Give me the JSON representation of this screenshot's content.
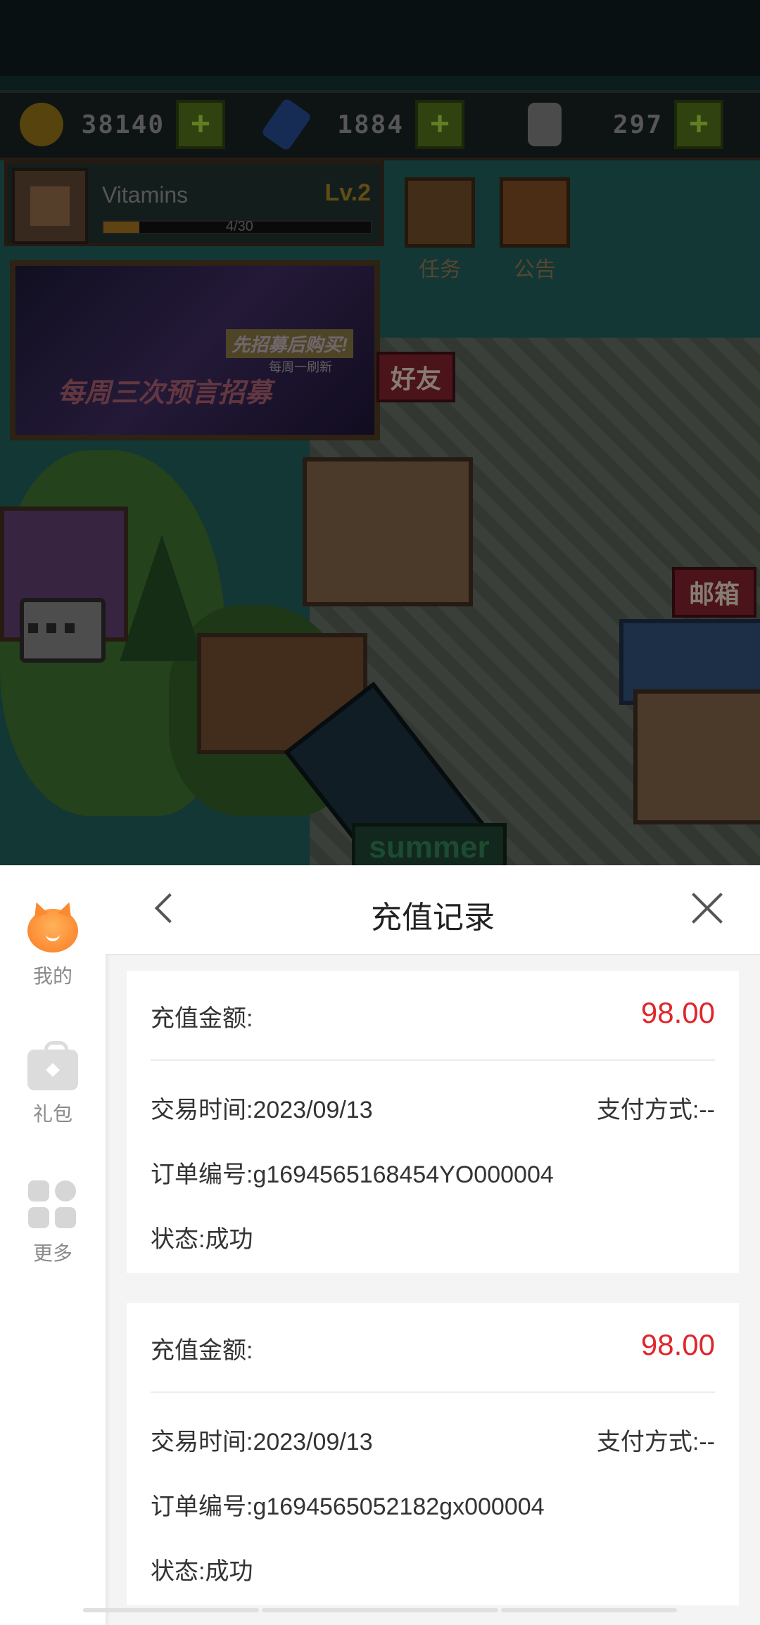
{
  "game": {
    "resources": [
      {
        "name": "gold",
        "value": "38140",
        "color": "#b28a1c"
      },
      {
        "name": "crystal",
        "value": "1884",
        "color": "#2e5aa8"
      },
      {
        "name": "bottle",
        "value": "297",
        "color": "#9a9a9a"
      }
    ],
    "player": {
      "name": "Vitamins",
      "level": "Lv.2",
      "exp": "4/30",
      "exp_progress": 0.133
    },
    "menu": {
      "task": "任务",
      "notice": "公告",
      "friend": "好友",
      "mailbox": "邮箱"
    },
    "banner": {
      "line1": "先招募后购买!",
      "line1_sub": "每周一刷新",
      "line2": "每周三次预言招募"
    },
    "summer_sign": "summer"
  },
  "sidenav": {
    "items": [
      {
        "label": "我的",
        "icon": "user-avatar-icon"
      },
      {
        "label": "礼包",
        "icon": "gift-icon"
      },
      {
        "label": "更多",
        "icon": "more-apps-icon"
      }
    ]
  },
  "panel": {
    "title": "充值记录",
    "records": [
      {
        "amount_label": "充值金额:",
        "amount": "98.00",
        "time_label": "交易时间:",
        "time": "2023/09/13",
        "pay_label": "支付方式:",
        "pay": "--",
        "order_label": "订单编号:",
        "order": "g1694565168454YO000004",
        "status_label": "状态:",
        "status": "成功"
      },
      {
        "amount_label": "充值金额:",
        "amount": "98.00",
        "time_label": "交易时间:",
        "time": "2023/09/13",
        "pay_label": "支付方式:",
        "pay": "--",
        "order_label": "订单编号:",
        "order": "g1694565052182gx000004",
        "status_label": "状态:",
        "status": "成功"
      }
    ]
  },
  "colors": {
    "amount": "#e0262b",
    "accent": "#fb7a22"
  }
}
